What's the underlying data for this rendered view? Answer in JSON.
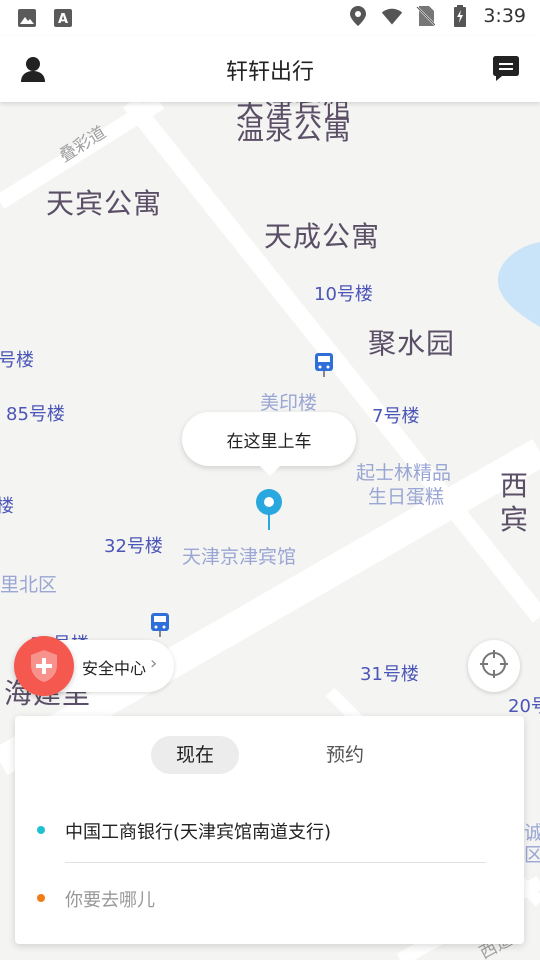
{
  "status_bar": {
    "time": "3:39",
    "left_icons": [
      "image-icon",
      "text-notification-icon"
    ],
    "right_icons": [
      "location-icon",
      "wifi-icon",
      "no-sim-icon",
      "battery-charging-icon"
    ]
  },
  "header": {
    "title": "轩轩出行",
    "left_icon": "user-icon",
    "right_icon": "message-icon"
  },
  "map": {
    "labels": {
      "partial_top": "天津宾馆",
      "wenquan": "温泉公寓",
      "tianbin": "天宾公寓",
      "tiancheng": "天成公寓",
      "b10": "10号楼",
      "jushuiyuan": "聚水园",
      "partial_left": "号楼",
      "b85": "85号楼",
      "meiyin": "美印楼",
      "b7": "7号楼",
      "qishilin_1": "起士林精品",
      "qishilin_2": "生日蛋糕",
      "xi_1": "西",
      "xi_2": "宾",
      "b32": "32号楼",
      "hotel": "天津京津宾馆",
      "lou_edge": "楼",
      "libeiqu": "里北区",
      "b31a": "31号楼",
      "haijiang": "海建里",
      "b31": "31号楼",
      "b20": "20号",
      "road_diecai": "叠彩道",
      "road_bottom": "西道",
      "partial_right_1": "诚",
      "partial_right_2": "区"
    },
    "pickup_bubble": "在这里上车"
  },
  "safety": {
    "label": "安全中心",
    "icon": "shield-plus-icon"
  },
  "locate_button": {
    "icon": "locate-crosshair-icon"
  },
  "booking_card": {
    "tabs": [
      {
        "label": "现在",
        "active": true
      },
      {
        "label": "预约",
        "active": false
      }
    ],
    "origin": "中国工商银行(天津宾馆南道支行)",
    "destination_placeholder": "你要去哪儿",
    "colors": {
      "origin_dot": "#1fc1d0",
      "destination_dot": "#f07d14"
    }
  },
  "colors": {
    "accent": "#29a8e0",
    "safety": "#f5584f"
  }
}
